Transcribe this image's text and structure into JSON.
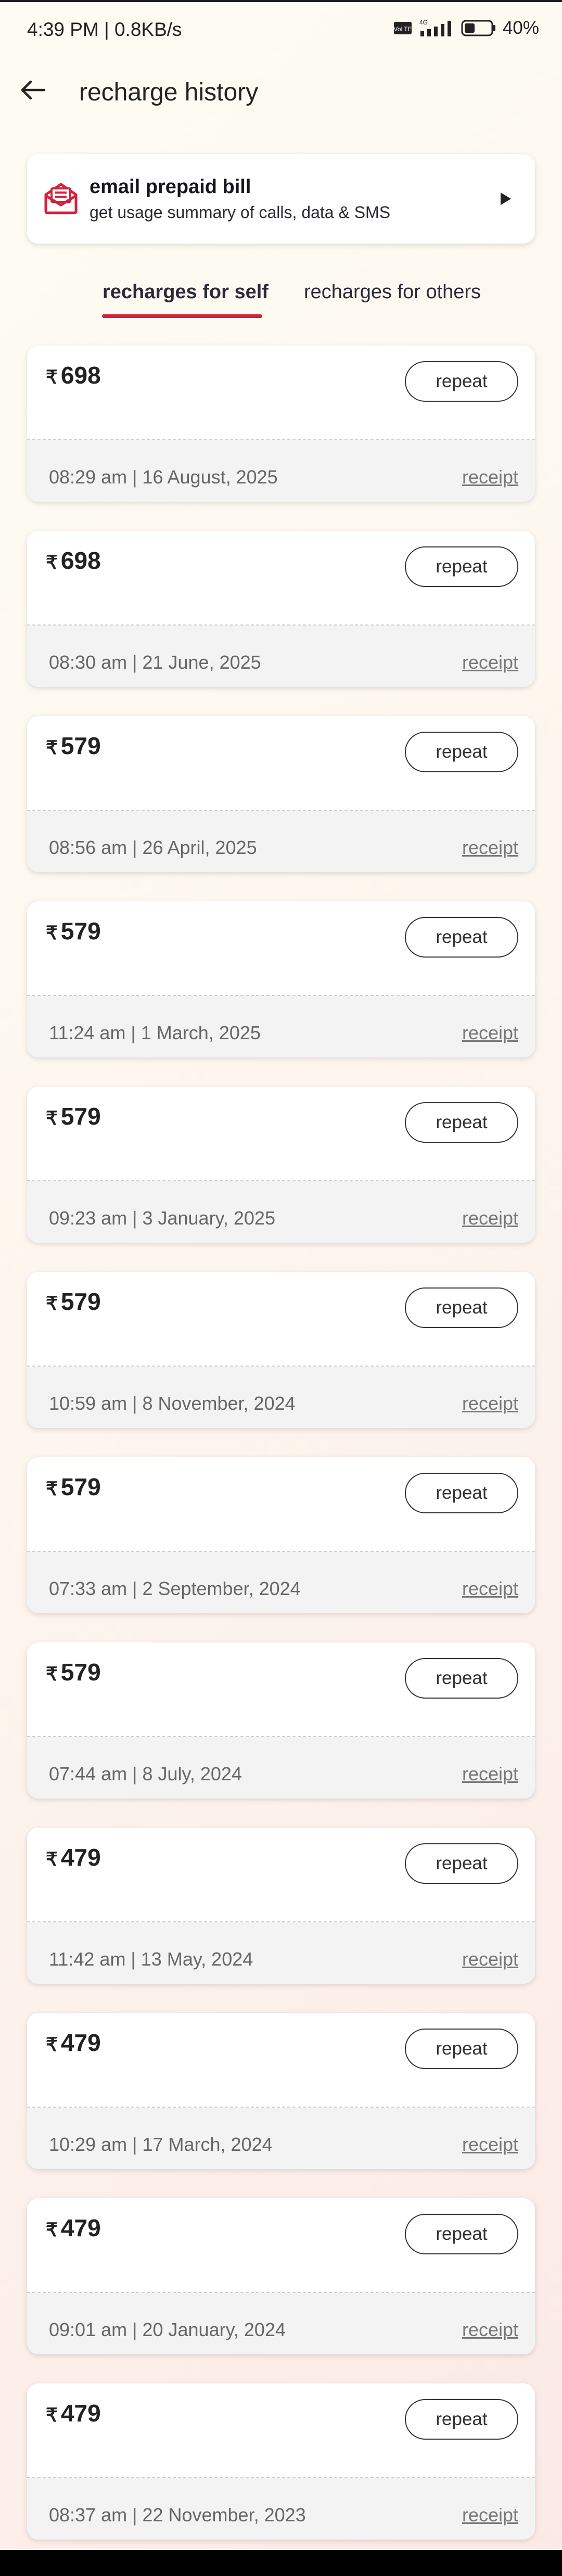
{
  "status_bar": {
    "time": "4:39 PM | 0.8KB/s",
    "network": "4G",
    "battery": "40"
  },
  "header": {
    "title": "recharge history"
  },
  "email_card": {
    "title": "email prepaid bill",
    "subtitle": "get usage summary of calls, data & SMS"
  },
  "tabs": [
    {
      "label": "recharges for self",
      "active": true
    },
    {
      "label": "recharges for others",
      "active": false
    }
  ],
  "currency_symbol": "₹",
  "recharges": [
    {
      "amount": "698",
      "datetime": "08:29 am | 16 August, 2025",
      "repeat_label": "repeat",
      "receipt_label": "receipt"
    },
    {
      "amount": "698",
      "datetime": "08:30 am | 21 June, 2025",
      "repeat_label": "repeat",
      "receipt_label": "receipt"
    },
    {
      "amount": "579",
      "datetime": "08:56 am | 26 April, 2025",
      "repeat_label": "repeat",
      "receipt_label": "receipt"
    },
    {
      "amount": "579",
      "datetime": "11:24 am | 1 March, 2025",
      "repeat_label": "repeat",
      "receipt_label": "receipt"
    },
    {
      "amount": "579",
      "datetime": "09:23 am | 3 January, 2025",
      "repeat_label": "repeat",
      "receipt_label": "receipt"
    },
    {
      "amount": "579",
      "datetime": "10:59 am | 8 November, 2024",
      "repeat_label": "repeat",
      "receipt_label": "receipt"
    },
    {
      "amount": "579",
      "datetime": "07:33 am | 2 September, 2024",
      "repeat_label": "repeat",
      "receipt_label": "receipt"
    },
    {
      "amount": "579",
      "datetime": "07:44 am | 8 July, 2024",
      "repeat_label": "repeat",
      "receipt_label": "receipt"
    },
    {
      "amount": "479",
      "datetime": "11:42 am | 13 May, 2024",
      "repeat_label": "repeat",
      "receipt_label": "receipt"
    },
    {
      "amount": "479",
      "datetime": "10:29 am | 17 March, 2024",
      "repeat_label": "repeat",
      "receipt_label": "receipt"
    },
    {
      "amount": "479",
      "datetime": "09:01 am | 20 January, 2024",
      "repeat_label": "repeat",
      "receipt_label": "receipt"
    },
    {
      "amount": "479",
      "datetime": "08:37 am | 22 November, 2023",
      "repeat_label": "repeat",
      "receipt_label": "receipt"
    }
  ],
  "icons": {
    "back": "arrow-left-icon",
    "email": "envelope-icon",
    "arrow": "play-arrow-icon"
  },
  "colors": {
    "accent": "#d6213a"
  }
}
